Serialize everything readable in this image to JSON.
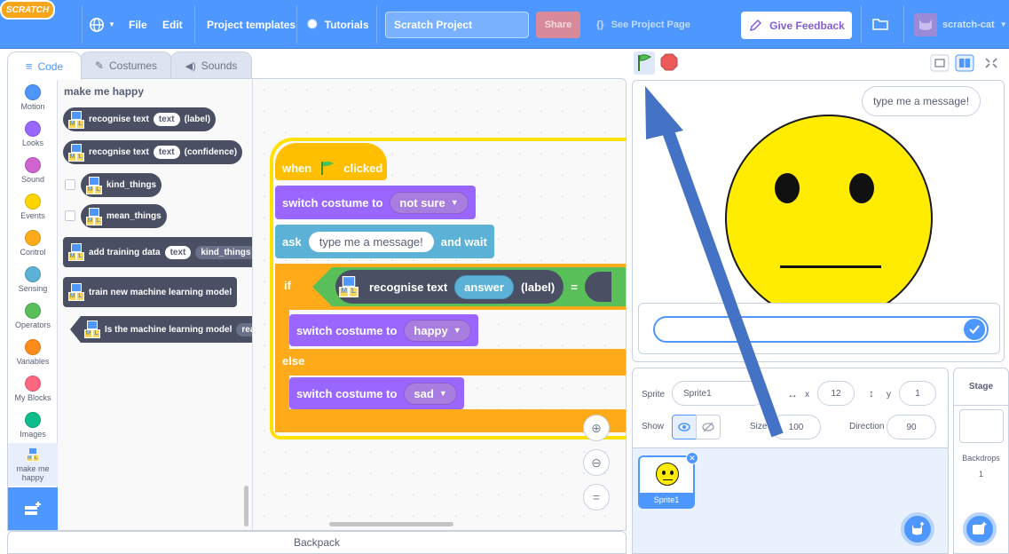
{
  "menubar": {
    "logo": "SCRATCH",
    "file": "File",
    "edit": "Edit",
    "project_templates": "Project templates",
    "tutorials": "Tutorials",
    "project_name": "Scratch Project",
    "share": "Share",
    "see_project_page": "See Project Page",
    "give_feedback": "Give Feedback",
    "username": "scratch-cat"
  },
  "tabs": {
    "code": "Code",
    "costumes": "Costumes",
    "sounds": "Sounds"
  },
  "categories": [
    {
      "label": "Motion",
      "color": "#4c97ff"
    },
    {
      "label": "Looks",
      "color": "#9966ff"
    },
    {
      "label": "Sound",
      "color": "#cf63cf"
    },
    {
      "label": "Events",
      "color": "#ffd500"
    },
    {
      "label": "Control",
      "color": "#ffab19"
    },
    {
      "label": "Sensing",
      "color": "#5cb1d6"
    },
    {
      "label": "Operators",
      "color": "#59c059"
    },
    {
      "label": "Variables",
      "color": "#ff8c1a"
    },
    {
      "label": "My Blocks",
      "color": "#ff6680"
    },
    {
      "label": "Images",
      "color": "#0fbd8c"
    },
    {
      "label": "make me happy",
      "color": "#4d97ff"
    }
  ],
  "palette": {
    "title": "make me happy",
    "blocks": [
      {
        "text": "recognise text",
        "slot": "text",
        "suffix": "(label)"
      },
      {
        "text": "recognise text",
        "slot": "text",
        "suffix": "(confidence)"
      },
      {
        "text": "kind_things"
      },
      {
        "text": "mean_things"
      },
      {
        "text": "add training data",
        "slot": "text",
        "slot2": "kind_things"
      },
      {
        "text": "train new machine learning model"
      },
      {
        "text": "Is the machine learning model",
        "slot": "read"
      }
    ]
  },
  "script": {
    "when": "when",
    "clicked": "clicked",
    "switch_costume": "switch costume to",
    "costume1": "not sure",
    "ask": "ask",
    "ask_text": "type me a message!",
    "and_wait": "and wait",
    "if": "if",
    "recognise_text": "recognise text",
    "answer": "answer",
    "label": "(label)",
    "equals": "=",
    "costume2": "happy",
    "else": "else",
    "costume3": "sad"
  },
  "backpack": "Backpack",
  "stage": {
    "speech_bubble": "type me a message!",
    "ask_input_value": ""
  },
  "sprite_info": {
    "sprite_label": "Sprite",
    "sprite_name": "Sprite1",
    "x_label": "x",
    "x": "12",
    "y_label": "y",
    "y": "1",
    "show_label": "Show",
    "size_label": "Size",
    "size": "100",
    "direction_label": "Direction",
    "direction": "90",
    "thumb_name": "Sprite1"
  },
  "stage_pane": {
    "title": "Stage",
    "backdrops_label": "Backdrops",
    "backdrops_count": "1"
  },
  "colors": {
    "menubar": "#4d97ff",
    "control": "#ffab19",
    "looks": "#9966ff",
    "sensing": "#5cb1d6",
    "operators": "#59c059",
    "events": "#ffbf00",
    "ml_block": "#4a4f63",
    "highlight": "#ffe200",
    "annotation_arrow": "#4472c4"
  }
}
